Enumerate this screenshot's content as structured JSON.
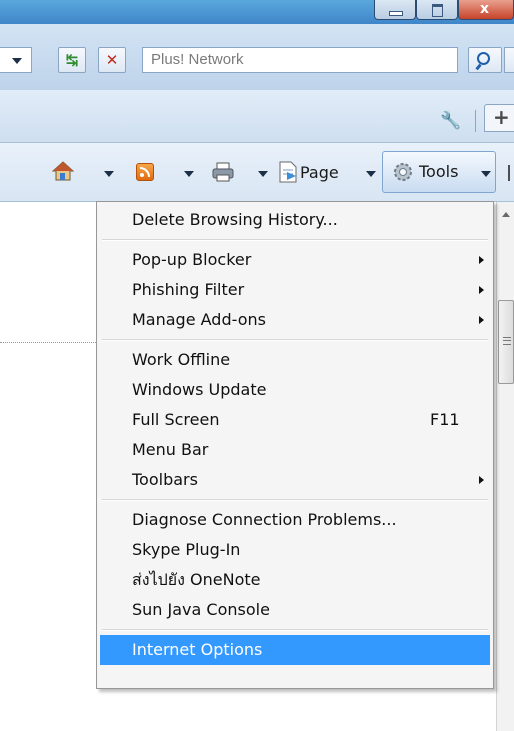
{
  "window": {
    "close_glyph": "x"
  },
  "address_bar": {
    "search_value": "Plus! Network"
  },
  "command_bar": {
    "page_label": "Page",
    "tools_label": "Tools"
  },
  "tools_menu": {
    "groups": [
      [
        {
          "label": "Delete Browsing History...",
          "submenu": false
        }
      ],
      [
        {
          "label": "Pop-up Blocker",
          "submenu": true
        },
        {
          "label": "Phishing Filter",
          "submenu": true
        },
        {
          "label": "Manage Add-ons",
          "submenu": true
        }
      ],
      [
        {
          "label": "Work Offline",
          "submenu": false
        },
        {
          "label": "Windows Update",
          "submenu": false
        },
        {
          "label": "Full Screen",
          "submenu": false,
          "shortcut": "F11"
        },
        {
          "label": "Menu Bar",
          "submenu": false
        },
        {
          "label": "Toolbars",
          "submenu": true
        }
      ],
      [
        {
          "label": "Diagnose Connection Problems...",
          "submenu": false
        },
        {
          "label": "Skype Plug-In",
          "submenu": false
        },
        {
          "label": "ส่งไปยัง OneNote",
          "submenu": false
        },
        {
          "label": "Sun Java Console",
          "submenu": false
        }
      ],
      [
        {
          "label": "Internet Options",
          "submenu": false,
          "highlighted": true
        }
      ]
    ]
  },
  "colors": {
    "menu_highlight": "#3399ff",
    "title_bar": "#3f86c9"
  },
  "icons": {
    "home": "home-icon",
    "feeds": "rss-icon",
    "print": "print-icon",
    "page": "page-icon",
    "tools": "gear-icon",
    "wrench": "wrench-icon",
    "search": "search-icon",
    "refresh": "refresh-icon",
    "stop": "stop-icon"
  }
}
